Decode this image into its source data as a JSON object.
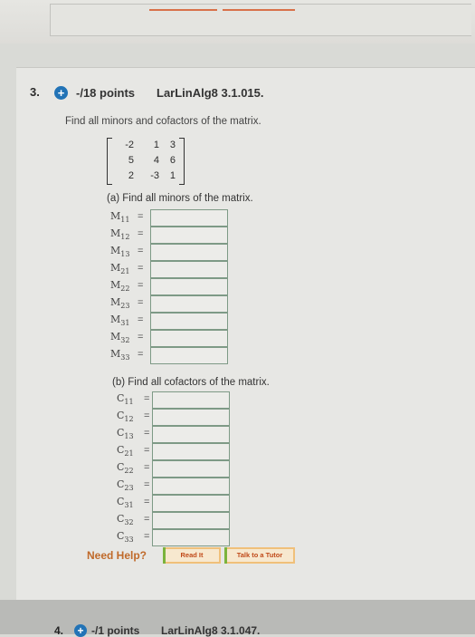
{
  "question": {
    "number": "3.",
    "plus_icon": "+",
    "points": "-/18 points",
    "code": "LarLinAlg8 3.1.015.",
    "instruction": "Find all minors and cofactors of the matrix.",
    "matrix": [
      [
        "-2",
        "1",
        "3"
      ],
      [
        "5",
        "4",
        "6"
      ],
      [
        "2",
        "-3",
        "1"
      ]
    ],
    "part_a": "(a) Find all minors of the matrix.",
    "minors": [
      {
        "base": "M",
        "sub": "11"
      },
      {
        "base": "M",
        "sub": "12"
      },
      {
        "base": "M",
        "sub": "13"
      },
      {
        "base": "M",
        "sub": "21"
      },
      {
        "base": "M",
        "sub": "22"
      },
      {
        "base": "M",
        "sub": "23"
      },
      {
        "base": "M",
        "sub": "31"
      },
      {
        "base": "M",
        "sub": "32"
      },
      {
        "base": "M",
        "sub": "33"
      }
    ],
    "part_b": "(b) Find all cofactors of the matrix.",
    "cofactors": [
      {
        "base": "C",
        "sub": "11"
      },
      {
        "base": "C",
        "sub": "12"
      },
      {
        "base": "C",
        "sub": "13"
      },
      {
        "base": "C",
        "sub": "21"
      },
      {
        "base": "C",
        "sub": "22"
      },
      {
        "base": "C",
        "sub": "23"
      },
      {
        "base": "C",
        "sub": "31"
      },
      {
        "base": "C",
        "sub": "32"
      },
      {
        "base": "C",
        "sub": "33"
      }
    ],
    "equals": "="
  },
  "help": {
    "label": "Need Help?",
    "read_it": "Read It",
    "talk_tutor": "Talk to a Tutor"
  },
  "next_question": {
    "number": "4.",
    "plus_icon": "+",
    "points": "-/1 points",
    "code": "LarLinAlg8 3.1.047."
  }
}
